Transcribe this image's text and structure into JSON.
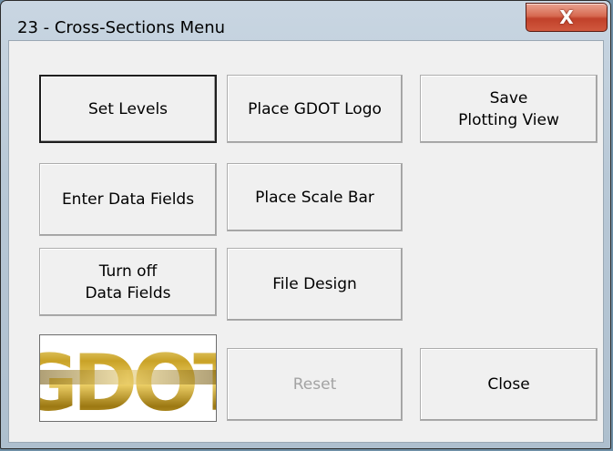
{
  "window": {
    "title": "23 - Cross-Sections Menu",
    "close_glyph": "X"
  },
  "buttons": {
    "set_levels": "Set Levels",
    "place_gdot_logo": "Place GDOT Logo",
    "save_plotting_view": "Save\nPlotting View",
    "enter_data_fields": "Enter Data Fields",
    "place_scale_bar": "Place Scale Bar",
    "turn_off_data_fields": "Turn off\nData Fields",
    "file_design": "File Design",
    "reset": "Reset",
    "close": "Close"
  },
  "logo": {
    "text": "GDOT",
    "colors": {
      "gold": "#c9a227",
      "dark_gold": "#8a6a0a",
      "light_gold": "#f4e08a"
    }
  },
  "colors": {
    "accent_close": "#c8442c",
    "disabled_text": "#a3a3a3"
  }
}
